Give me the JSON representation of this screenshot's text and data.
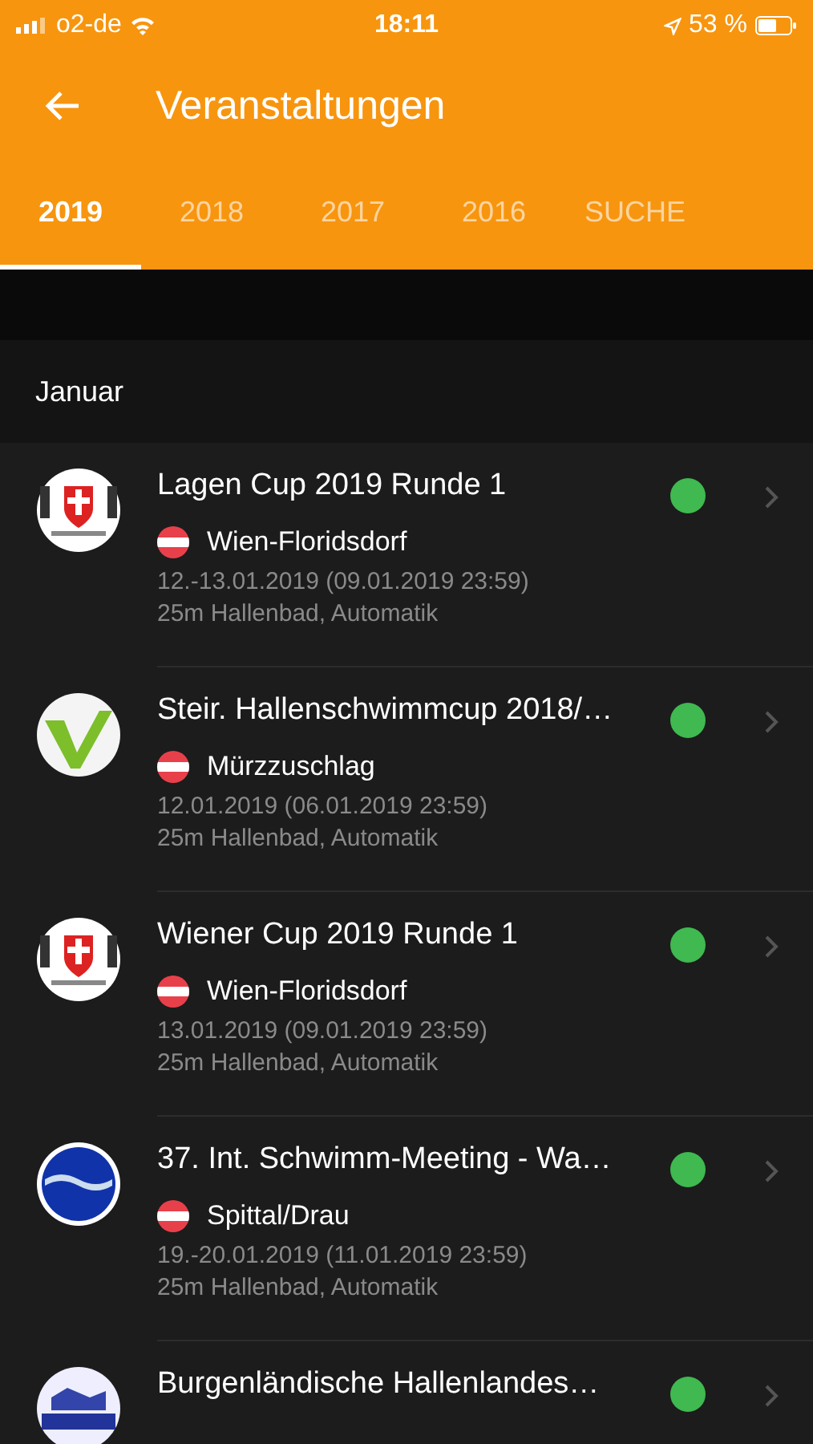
{
  "status_bar": {
    "carrier": "o2-de",
    "time": "18:11",
    "battery": "53 %"
  },
  "header": {
    "title": "Veranstaltungen"
  },
  "tabs": [
    {
      "label": "2019",
      "selected": true
    },
    {
      "label": "2018",
      "selected": false
    },
    {
      "label": "2017",
      "selected": false
    },
    {
      "label": "2016",
      "selected": false
    },
    {
      "label": "SUCHE",
      "selected": false
    }
  ],
  "section": "Januar",
  "events": [
    {
      "kind": "shield",
      "title": "Lagen Cup 2019 Runde 1",
      "location": "Wien-Floridsdorf",
      "dates": "12.-13.01.2019 (09.01.2019 23:59)",
      "info": "25m Hallenbad, Automatik",
      "color": "#3fb950"
    },
    {
      "kind": "check",
      "title": "Steir. Hallenschwimmcup 2018/…",
      "location": "Mürzzuschlag",
      "dates": "12.01.2019 (06.01.2019 23:59)",
      "info": "25m Hallenbad, Automatik",
      "color": "#3fb950"
    },
    {
      "kind": "shield",
      "title": "Wiener Cup 2019 Runde 1",
      "location": "Wien-Floridsdorf",
      "dates": "13.01.2019 (09.01.2019 23:59)",
      "info": "25m Hallenbad, Automatik",
      "color": "#3fb950"
    },
    {
      "kind": "wave",
      "title": "37. Int. Schwimm-Meeting - Wa…",
      "location": "Spittal/Drau",
      "dates": "19.-20.01.2019 (11.01.2019 23:59)",
      "info": "25m Hallenbad, Automatik",
      "color": "#3fb950"
    },
    {
      "kind": "pool",
      "title": "Burgenländische Hallenlandes…",
      "color": "#3fb950"
    }
  ]
}
